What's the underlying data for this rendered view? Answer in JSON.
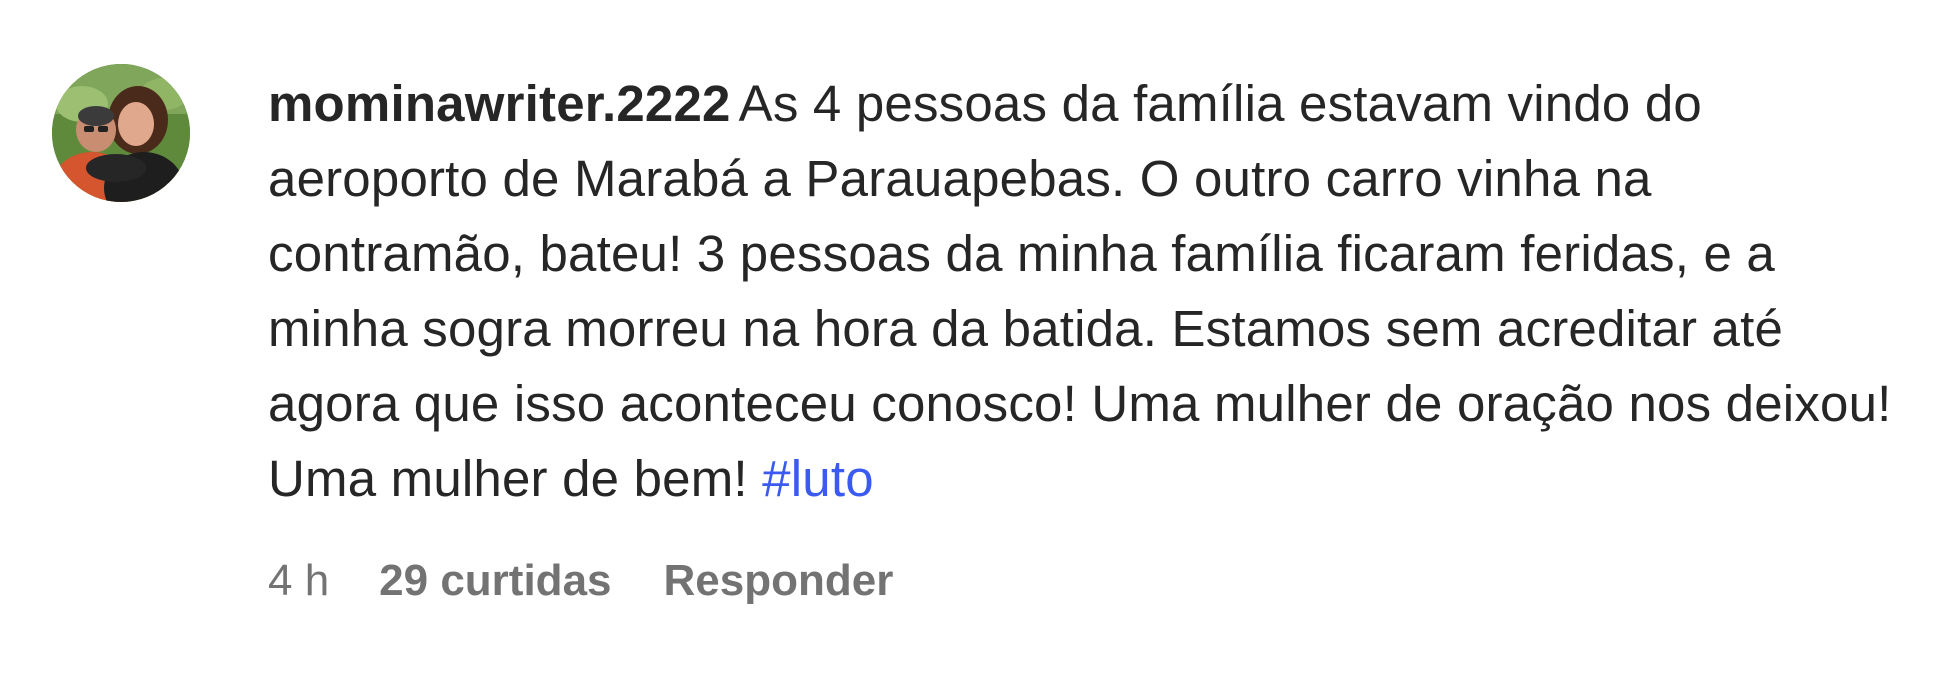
{
  "comment": {
    "username": "mominawriter.2222",
    "text": "As 4 pessoas da família estavam vindo do aeroporto de Marabá a Parauapebas. O outro carro vinha na contramão, bateu! 3 pessoas da minha família ficaram feridas, e a minha sogra morreu na hora da batida. Estamos sem acreditar até agora que isso aconteceu conosco! Uma mulher de oração nos deixou! Uma mulher de bem!",
    "hashtag": "#luto",
    "time": "4 h",
    "likes": "29 curtidas",
    "reply_label": "Responder"
  },
  "colors": {
    "text": "#262626",
    "muted": "#737373",
    "link": "#3b5bf0"
  }
}
